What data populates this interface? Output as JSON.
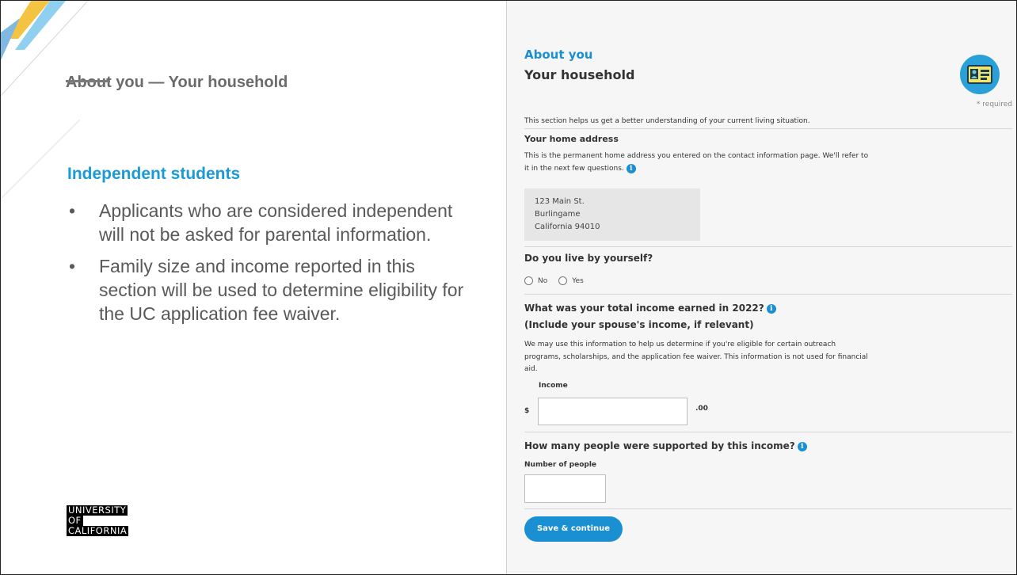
{
  "slide": {
    "title": "About you — Your household",
    "subhead": "Independent students",
    "bullets": [
      "Applicants who are considered independent will not be asked for parental information.",
      "Family size and income reported in this section will be used to determine eligibility for the UC application fee waiver."
    ],
    "bullet_marker": "•",
    "logo_lines": [
      "UNIVERSITY",
      "OF",
      "CALIFORNIA"
    ]
  },
  "form": {
    "section": "About you",
    "title": "Your household",
    "required_note": "* required",
    "intro": "This section helps us get a better understanding of your current living situation.",
    "home_address": {
      "heading": "Your home address",
      "desc_line1": "This is the permanent home address you entered on the contact information page. We'll refer to",
      "desc_line2": "it in the next few questions.",
      "lines": [
        "123 Main St.",
        "Burlingame",
        "California 94010"
      ]
    },
    "live_alone": {
      "question": "Do you live by yourself?",
      "options": [
        "No",
        "Yes"
      ]
    },
    "income": {
      "question_line1": "What was your total income earned in 2022?",
      "question_line2": "(Include your spouse's income, if relevant)",
      "desc_line1": "We may use this information to help us determine if you're eligible for certain outreach",
      "desc_line2": "programs, scholarships, and the application fee waiver. This information is not used for financial",
      "desc_line3": "aid.",
      "field_label": "Income",
      "currency": "$",
      "cents": ".00",
      "value": ""
    },
    "people": {
      "question": "How many people were supported by this income?",
      "field_label": "Number of people",
      "value": ""
    },
    "save_label": "Save & continue",
    "info_glyph": "i"
  },
  "colors": {
    "accent": "#1a8fd1",
    "subhead": "#1a9ad6",
    "panel_bg": "#f6f6f6"
  }
}
